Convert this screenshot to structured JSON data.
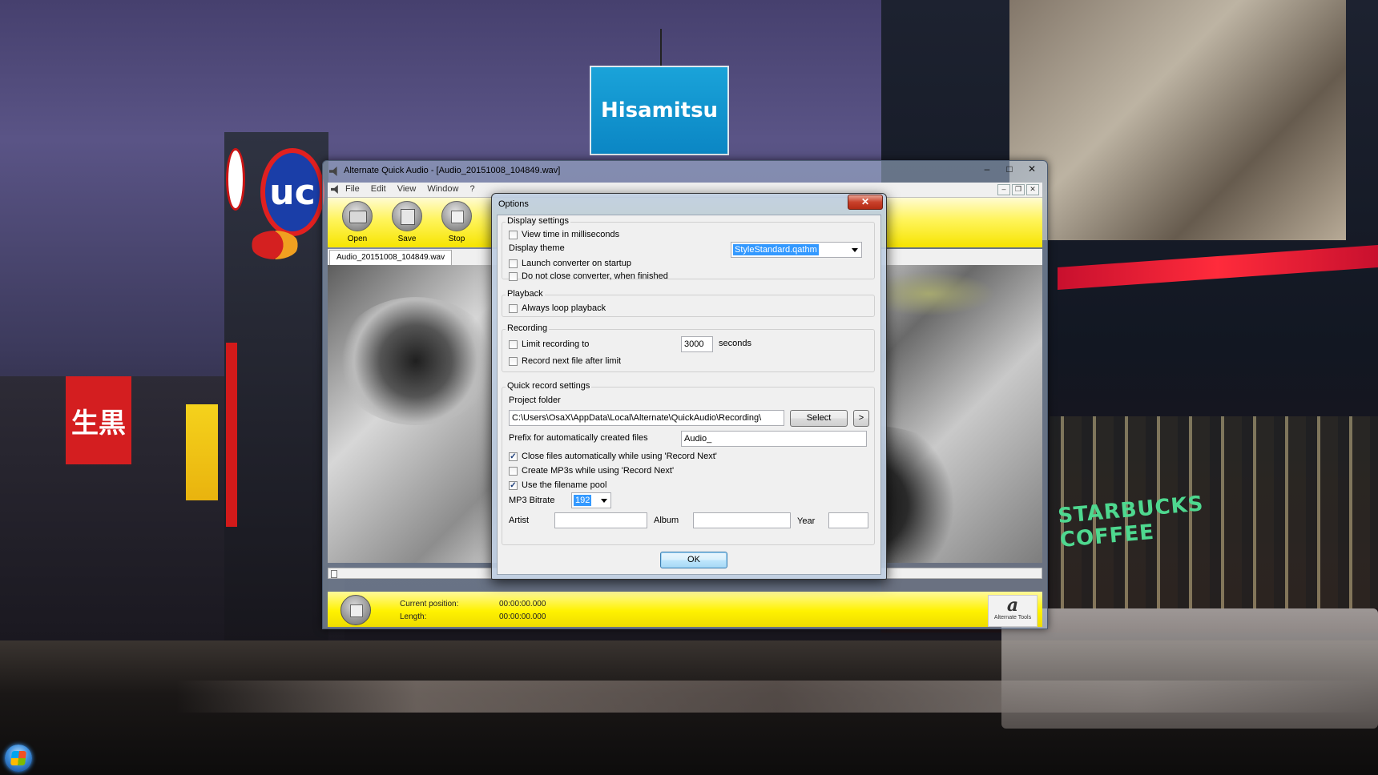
{
  "desktop": {
    "signs": {
      "hisamitsu": "Hisamitsu",
      "uc": "uc",
      "kanji": "生黒",
      "starbucks": "STARBUCKS COFFEE"
    }
  },
  "app": {
    "title": "Alternate Quick Audio - [Audio_20151008_104849.wav]",
    "window_buttons": {
      "minimize": "–",
      "maximize": "□",
      "close": "✕"
    },
    "menu": [
      "File",
      "Edit",
      "View",
      "Window",
      "?"
    ],
    "mdi_buttons": {
      "minimize": "–",
      "restore": "❐",
      "close": "✕"
    },
    "toolbar": {
      "open": "Open",
      "save": "Save",
      "stop": "Stop"
    },
    "doc_tab": "Audio_20151008_104849.wav",
    "status": {
      "current_position_label": "Current position:",
      "current_position_value": "00:00:00.000",
      "length_label": "Length:",
      "length_value": "00:00:00.000"
    },
    "brand": {
      "mark": "a",
      "text": "Alternate Tools"
    }
  },
  "options": {
    "title": "Options",
    "close_label": "✕",
    "display_settings": {
      "title": "Display settings",
      "view_ms": {
        "label": "View time in milliseconds",
        "checked": false
      },
      "theme_label": "Display theme",
      "theme_value": "StyleStandard.qathm",
      "launch_converter": {
        "label": "Launch converter on startup",
        "checked": false
      },
      "no_close_converter": {
        "label": "Do not close converter, when finished",
        "checked": false
      }
    },
    "playback": {
      "title": "Playback",
      "always_loop": {
        "label": "Always loop playback",
        "checked": false
      }
    },
    "recording": {
      "title": "Recording",
      "limit": {
        "label": "Limit recording to",
        "checked": false
      },
      "limit_value": "3000",
      "seconds_label": "seconds",
      "record_next": {
        "label": "Record next file after limit",
        "checked": false
      }
    },
    "quick_record": {
      "title": "Quick record settings",
      "project_folder_label": "Project folder",
      "project_folder_value": "C:\\Users\\OsaX\\AppData\\Local\\Alternate\\QuickAudio\\Recording\\",
      "select_button": "Select",
      "more_button": ">",
      "prefix_label": "Prefix for automatically created files",
      "prefix_value": "Audio_",
      "close_files": {
        "label": "Close files automatically while using 'Record Next'",
        "checked": true
      },
      "create_mp3": {
        "label": "Create MP3s while using 'Record Next'",
        "checked": false
      },
      "filename_pool": {
        "label": "Use the filename pool",
        "checked": true
      },
      "bitrate_label": "MP3 Bitrate",
      "bitrate_value": "192",
      "artist_label": "Artist",
      "artist_value": "",
      "album_label": "Album",
      "album_value": "",
      "year_label": "Year",
      "year_value": ""
    },
    "ok_button": "OK"
  }
}
